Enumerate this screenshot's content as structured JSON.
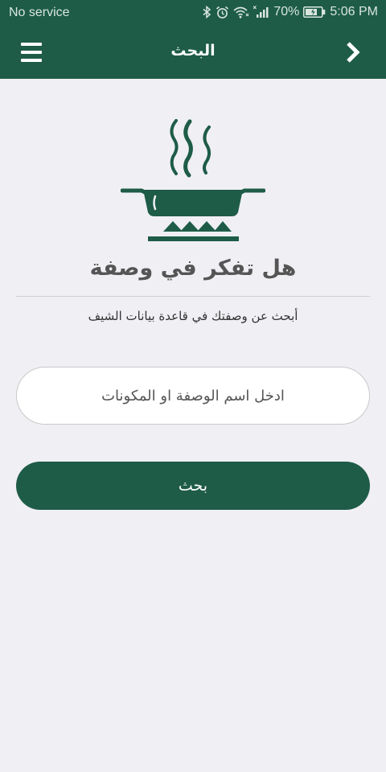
{
  "status_bar": {
    "carrier": "No service",
    "battery": "70%",
    "time": "5:06 PM"
  },
  "app_bar": {
    "title": "البحث",
    "menu_icon": "hamburger-menu-icon",
    "forward_icon": "chevron-right-icon"
  },
  "main": {
    "logo_icon": "steaming-pot-on-stove-icon",
    "headline": "هل تفكر في وصفة",
    "subtitle": "أبحث عن وصفتك في قاعدة بيانات الشيف",
    "search": {
      "placeholder": "ادخل اسم الوصفة او المكونات",
      "value": ""
    },
    "search_button_label": "بحث"
  },
  "colors": {
    "brand": "#1e5c47",
    "background": "#f0eff4",
    "headline_text": "#555555"
  }
}
